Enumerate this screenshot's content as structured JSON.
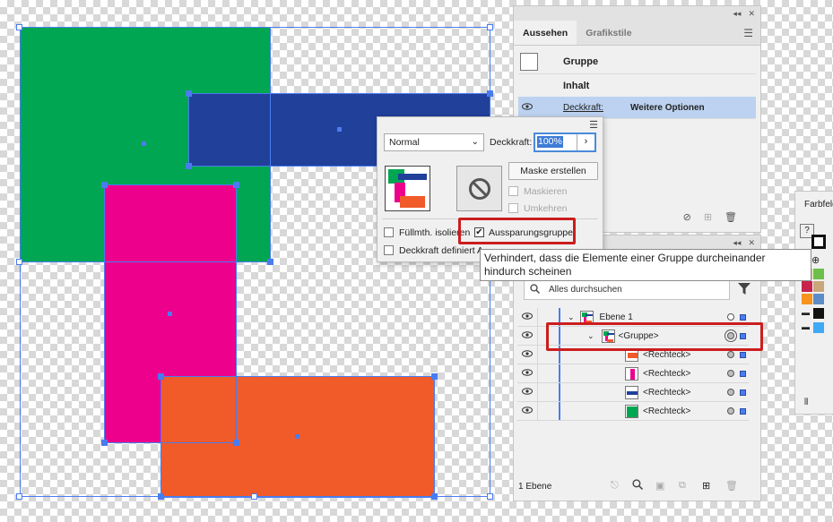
{
  "appearance_panel": {
    "tabs": [
      "Aussehen",
      "Grafikstile"
    ],
    "group_label": "Gruppe",
    "content_label": "Inhalt",
    "opacity_label": "Deckkraft:",
    "more_options": "Weitere Optionen"
  },
  "transparency": {
    "blend_mode": "Normal",
    "opacity_label": "Deckkraft:",
    "opacity_value": "100%",
    "make_mask": "Maske erstellen",
    "clip": "Maskieren",
    "invert": "Umkehren",
    "isolate_blending": "Füllmth. isolieren",
    "knockout_group": "Aussparungsgruppe",
    "opacity_defines": "Deckkraft definiert A"
  },
  "tooltip": {
    "text": "Verhindert, dass die Elemente einer Gruppe durcheinander hindurch scheinen"
  },
  "layers_panel": {
    "search_placeholder": "Alles durchsuchen",
    "layer_name": "Ebene 1",
    "group_name": "<Gruppe>",
    "rect_1": "<Rechteck>",
    "rect_2": "<Rechteck>",
    "rect_3": "<Rechteck>",
    "rect_4": "<Rechteck>",
    "footer": "1 Ebene"
  },
  "swatches_panel": {
    "title": "Farbfeld",
    "unknown_marker": "?"
  },
  "colors": {
    "green": "#00a651",
    "blue": "#21409a",
    "magenta": "#ec008c",
    "orange": "#f15a29",
    "selection": "#4a7cf0",
    "highlight": "#cc1d1d"
  }
}
